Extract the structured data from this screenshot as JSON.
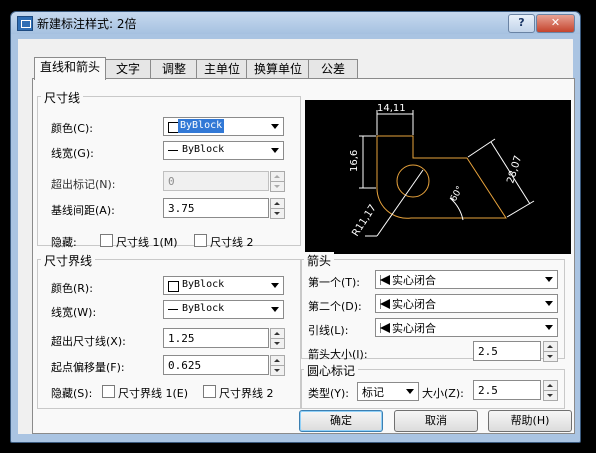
{
  "window": {
    "title": "新建标注样式: 2倍",
    "help_label": "?",
    "close_label": "✕"
  },
  "tabs": [
    "直线和箭头",
    "文字",
    "调整",
    "主单位",
    "换算单位",
    "公差"
  ],
  "dim_line": {
    "group_title": "尺寸线",
    "color_label": "颜色(C):",
    "color_value": "ByBlock",
    "lineweight_label": "线宽(G):",
    "lineweight_value": "ByBlock",
    "extend_label": "超出标记(N):",
    "extend_value": "0",
    "baseline_label": "基线间距(A):",
    "baseline_value": "3.75",
    "suppress_label": "隐藏:",
    "suppress1": "尺寸线 1(M)",
    "suppress2": "尺寸线 2"
  },
  "ext_line": {
    "group_title": "尺寸界线",
    "color_label": "颜色(R):",
    "color_value": "ByBlock",
    "lineweight_label": "线宽(W):",
    "lineweight_value": "ByBlock",
    "extend_label": "超出尺寸线(X):",
    "extend_value": "1.25",
    "offset_label": "起点偏移量(F):",
    "offset_value": "0.625",
    "suppress_label": "隐藏(S):",
    "suppress1": "尺寸界线 1(E)",
    "suppress2": "尺寸界线 2"
  },
  "preview": {
    "dim_top": "14,11",
    "dim_left": "16,6",
    "dim_right": "28,07",
    "dim_angle": "60°",
    "dim_radius": "R11,17",
    "line_color": "#e8a33c"
  },
  "arrows": {
    "group_title": "箭头",
    "first_label": "第一个(T):",
    "first_value": "实心闭合",
    "second_label": "第二个(D):",
    "second_value": "实心闭合",
    "leader_label": "引线(L):",
    "leader_value": "实心闭合",
    "size_label": "箭头大小(I):",
    "size_value": "2.5"
  },
  "center": {
    "group_title": "圆心标记",
    "type_label": "类型(Y):",
    "type_value": "标记",
    "size_label": "大小(Z):",
    "size_value": "2.5"
  },
  "buttons": {
    "ok": "确定",
    "cancel": "取消",
    "help": "帮助(H)"
  }
}
